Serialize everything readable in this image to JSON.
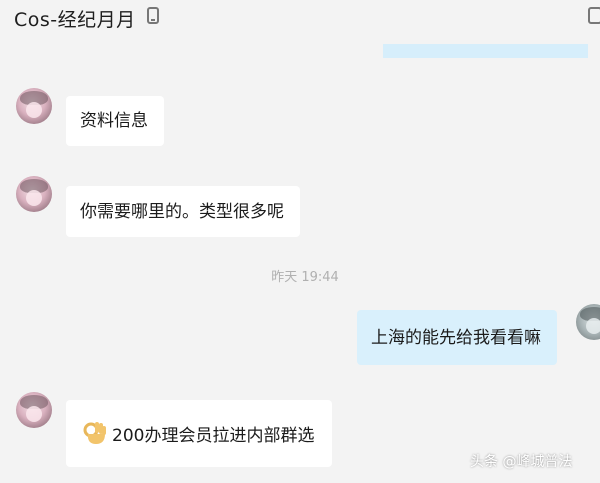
{
  "header": {
    "contact_name": "Cos-经纪月月",
    "phone_icon": "phone-icon",
    "more_icon": "more-icon"
  },
  "messages": [
    {
      "side": "left",
      "text": "资料信息"
    },
    {
      "side": "left",
      "text": "你需要哪里的。类型很多呢"
    },
    {
      "type": "time",
      "text": "昨天  19:44"
    },
    {
      "side": "right",
      "text": "上海的能先给我看看嘛"
    },
    {
      "side": "left",
      "emoji": "ok-hand-icon",
      "text": "200办理会员拉进内部群选"
    }
  ],
  "watermark": "头条 @峰城普法",
  "colors": {
    "background": "#f3f3f3",
    "incoming_bubble": "#ffffff",
    "outgoing_bubble": "#d9f0fc",
    "time_text": "#b0b0b0"
  }
}
